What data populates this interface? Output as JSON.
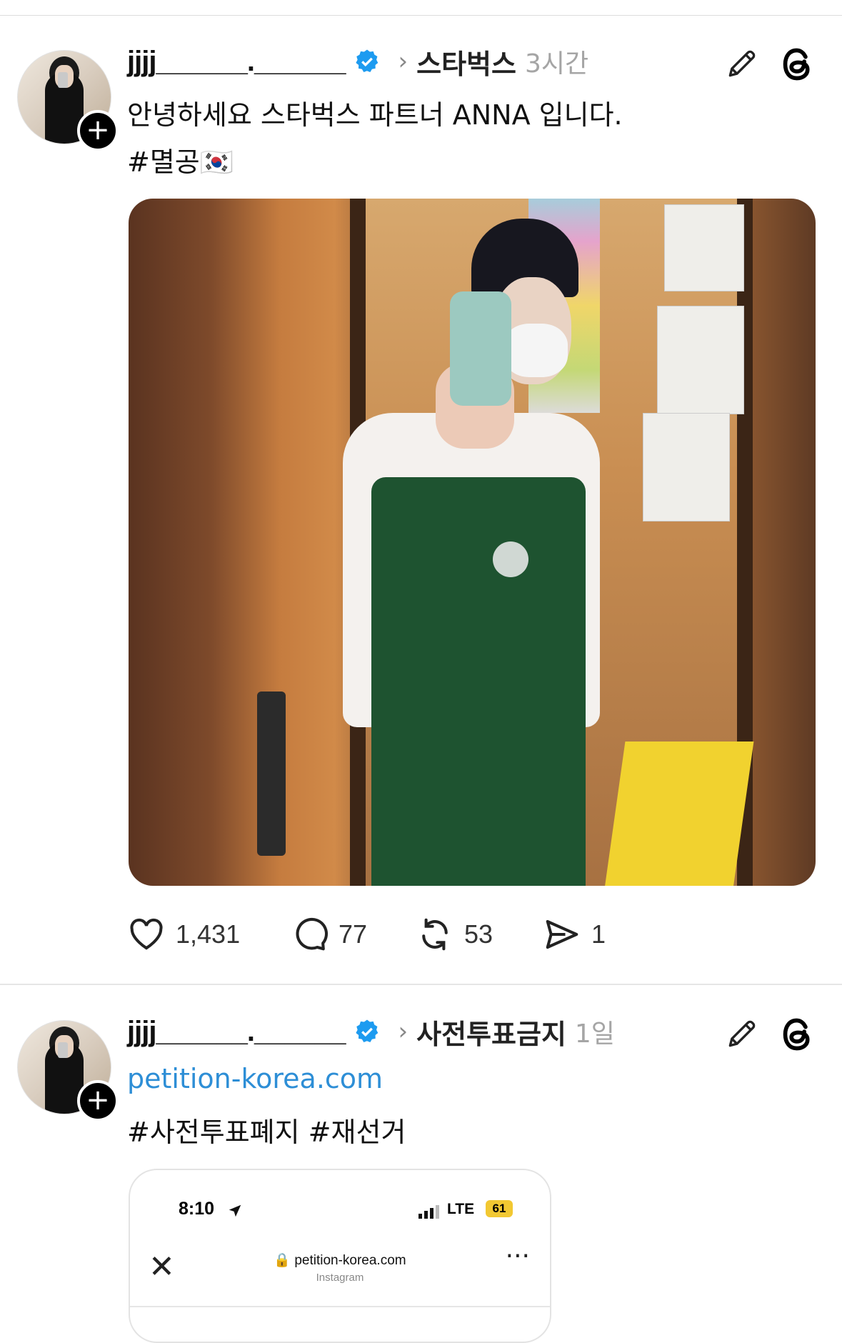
{
  "posts": [
    {
      "username": "jjjj______.______",
      "community": "스타벅스",
      "time": "3시간",
      "text_line1": "안녕하세요 스타벅스 파트너 ANNA 입니다.",
      "text_line2": "#멸공🇰🇷",
      "stats": {
        "likes": "1,431",
        "comments": "77",
        "reposts": "53",
        "shares": "1"
      }
    },
    {
      "username": "jjjj______.______",
      "community": "사전투표금지",
      "time": "1일",
      "link": "petition-korea.com",
      "text_line2": "#사전투표폐지 #재선거",
      "card": {
        "clock": "8:10",
        "network": "LTE",
        "battery": "61",
        "domain": "petition-korea.com",
        "subtitle": "Instagram"
      }
    }
  ],
  "colors": {
    "verified": "#1d9bf0",
    "link": "#2d8ed6"
  }
}
